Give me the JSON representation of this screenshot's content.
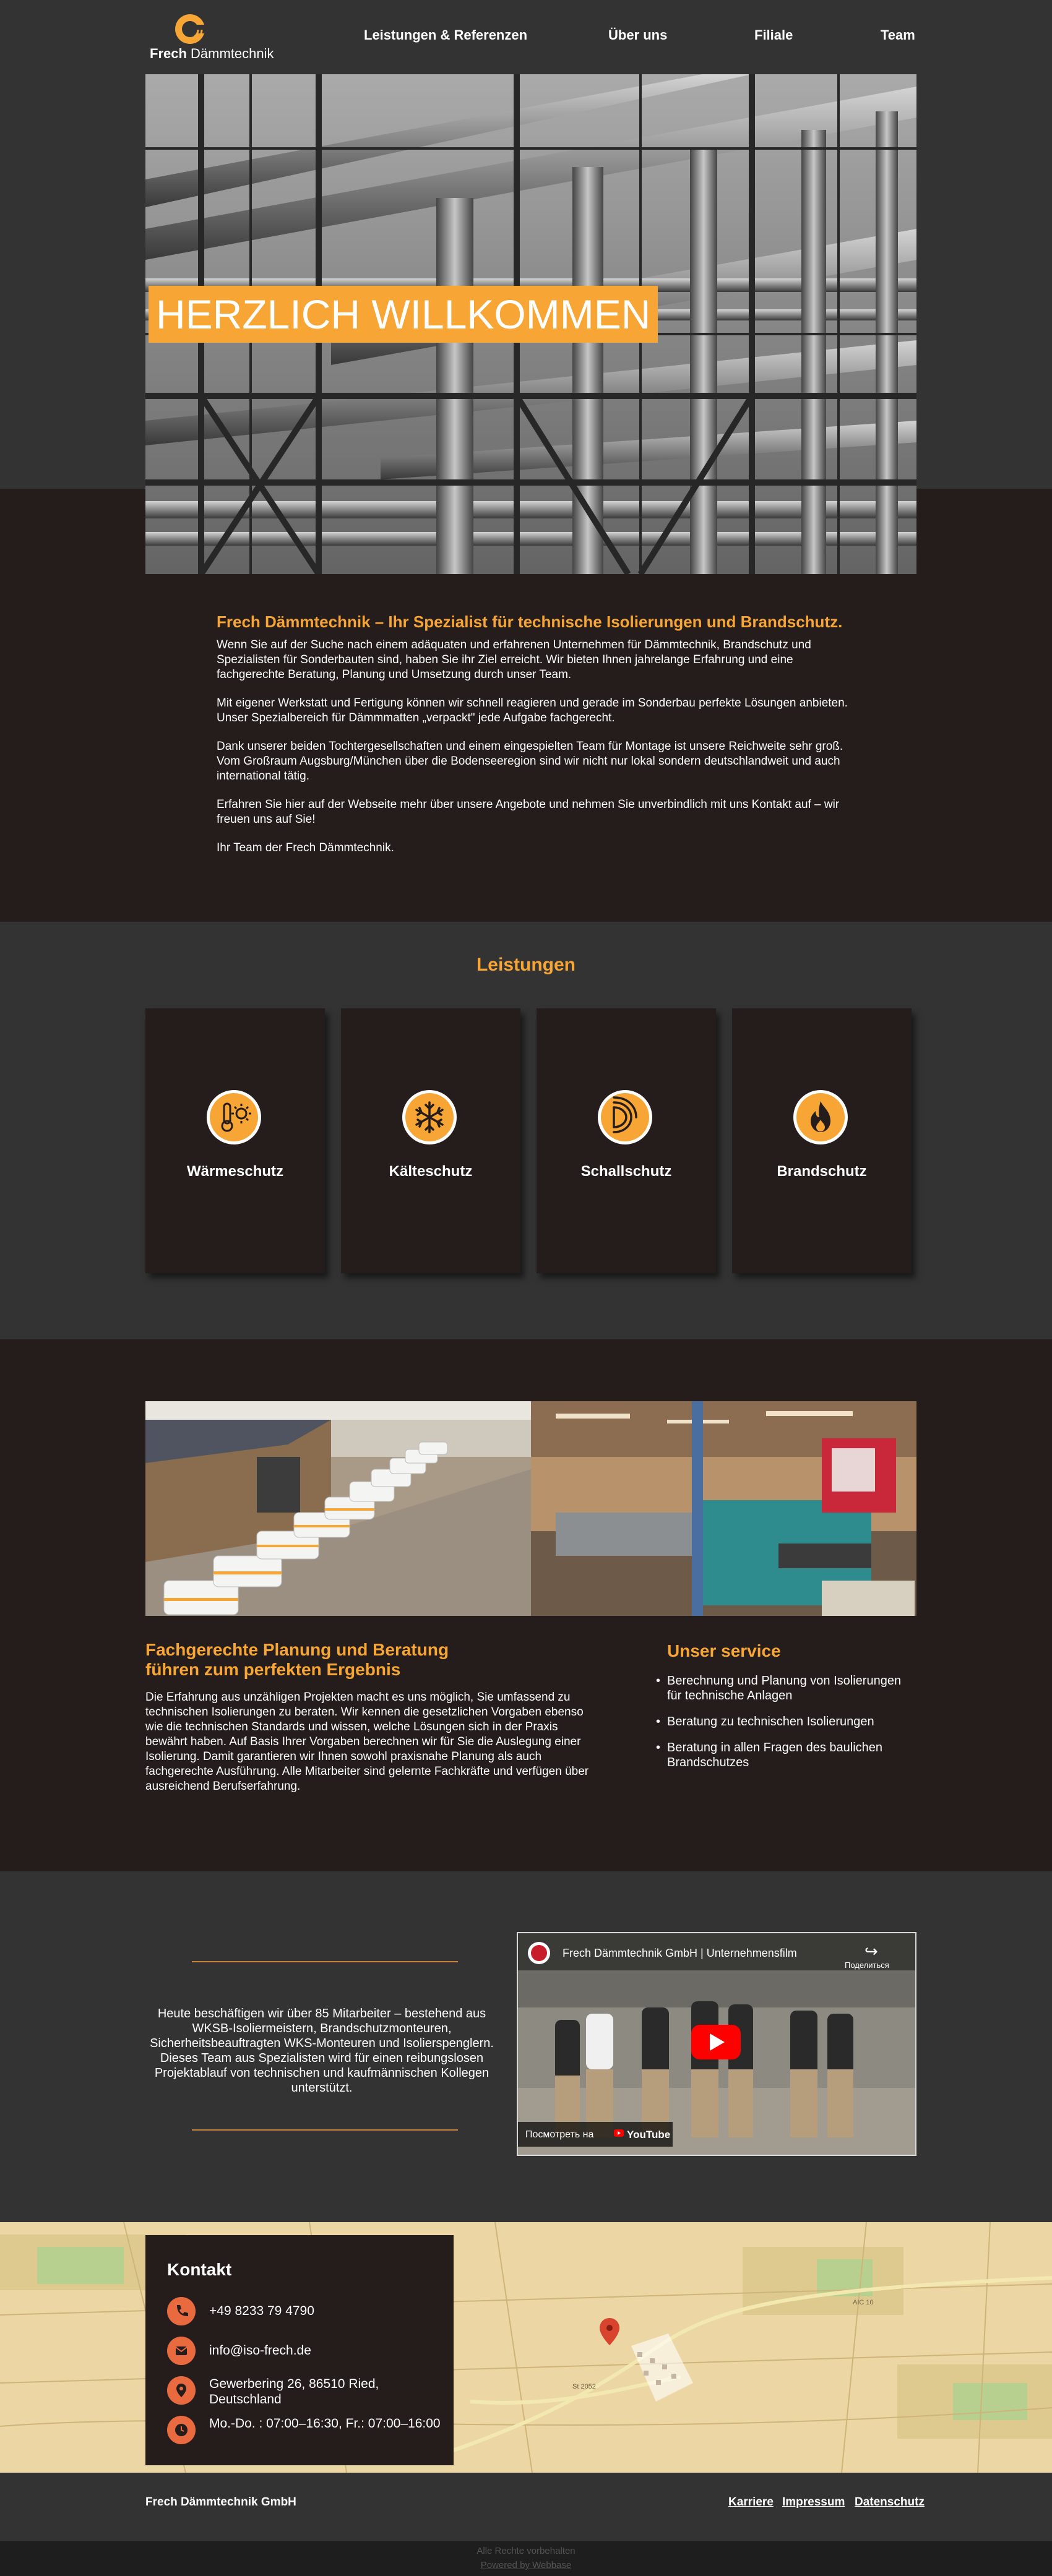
{
  "header": {
    "logo_brand": "Frech",
    "logo_suffix": "Dämmtechnik",
    "nav": [
      "Leistungen & Referenzen",
      "Über uns",
      "Filiale",
      "Team"
    ]
  },
  "hero": {
    "title": "HERZLICH WILLKOMMEN"
  },
  "intro": {
    "heading": "Frech Dämmtechnik – Ihr Spezialist für technische Isolierungen und Brandschutz.",
    "paragraphs": [
      "Wenn Sie auf der Suche nach einem adäquaten und erfahrenen Unternehmen für Dämmtechnik, Brandschutz und Spezialisten für Sonderbauten sind, haben Sie ihr Ziel erreicht. Wir bieten Ihnen jahrelange Erfahrung und eine fachgerechte Beratung, Planung und Umsetzung durch unser Team.",
      "Mit eigener Werkstatt und Fertigung können wir schnell reagieren und gerade im Sonderbau perfekte Lösungen anbieten. Unser Spezialbereich für Dämmmatten „verpackt\" jede Aufgabe fachgerecht.",
      "Dank unserer beiden Tochtergesellschaften und einem eingespielten Team für Montage ist unsere Reichweite sehr groß. Vom Großraum Augsburg/München über die Bodenseeregion sind wir nicht nur lokal sondern deutschlandweit und auch international tätig.",
      "Erfahren Sie hier auf der Webseite mehr über unsere Angebote und nehmen Sie unverbindlich mit uns Kontakt auf – wir freuen uns auf Sie!",
      "Ihr Team der Frech Dämmtechnik."
    ]
  },
  "leistungen": {
    "title": "Leistungen",
    "cards": [
      {
        "label": "Wärmeschutz",
        "icon": "thermometer-sun-icon"
      },
      {
        "label": "Kälteschutz",
        "icon": "snowflake-icon"
      },
      {
        "label": "Schallschutz",
        "icon": "sound-waves-icon"
      },
      {
        "label": "Brandschutz",
        "icon": "flame-icon"
      }
    ]
  },
  "planning": {
    "title_line1": "Fachgerechte Planung und Beratung",
    "title_line2": "führen zum perfekten Ergebnis",
    "text": "Die Erfahrung aus unzähligen Projekten macht es uns möglich, Sie umfassend zu technischen Isolierungen zu beraten. Wir kennen die gesetzlichen Vorgaben ebenso wie die technischen Standards und wissen, welche Lösungen sich in der Praxis bewährt haben. Auf Basis Ihrer Vorgaben berechnen wir für Sie die Auslegung einer Isolierung. Damit garantieren wir Ihnen sowohl praxisnahe Planung als auch fachgerechte Ausführung. Alle Mitarbeiter sind gelernte Fachkräfte und verfügen über ausreichend Berufserfahrung."
  },
  "service": {
    "title": "Unser service",
    "items": [
      "Berechnung und Planung von Isolierungen für technische Anlagen",
      "Beratung zu technischen Isolierungen",
      "Beratung in allen Fragen des baulichen Brandschutzes"
    ]
  },
  "team": {
    "text": "Heute beschäftigen wir über 85 Mitarbeiter – bestehend aus WKSB-Isoliermeistern, Brandschutzmonteuren, Sicherheitsbeauftragten WKS-Monteuren und Isolierspenglern. Dieses Team aus Spezialisten wird für einen reibungslosen Projektablauf von technischen und kaufmännischen Kollegen unterstützt.",
    "video_title": "Frech Dämmtechnik GmbH | Unternehmensfilm",
    "video_share": "Поделиться",
    "video_watch": "Посмотреть на",
    "video_platform": "YouTube"
  },
  "contact": {
    "title": "Kontakt",
    "phone": "+49 8233 79 4790",
    "email": "info@iso-frech.de",
    "address": "Gewerbering 26, 86510 Ried, Deutschland",
    "hours": "Mo.-Do. : 07:00–16:30, Fr.: 07:00–16:00",
    "map_labels": [
      "St 2052",
      "AIC 10"
    ]
  },
  "footer": {
    "company": "Frech Dämmtechnik GmbH",
    "links": [
      "Karriere",
      "Impressum",
      "Datenschutz"
    ],
    "rights": "Alle Rechte vorbehalten",
    "powered": "Powered by Webbase"
  },
  "colors": {
    "accent": "#f7a535",
    "dark": "#241d1b",
    "panel": "#333333",
    "contact_icon": "#e86a3e"
  }
}
